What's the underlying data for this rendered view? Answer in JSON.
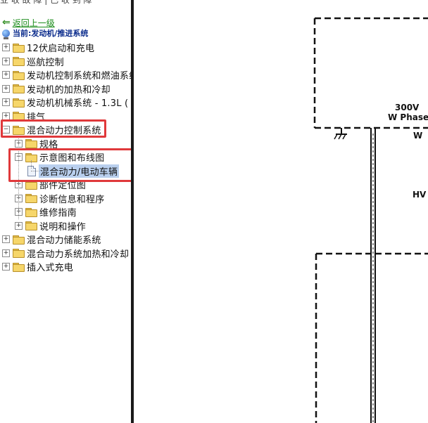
{
  "header": {
    "top_cut_text": "业 收 故 障 | 已 收 到 障"
  },
  "nav": {
    "back_label": "返回上一级",
    "current_label": "当前:发动机/推进系统"
  },
  "tree": {
    "items": [
      {
        "label": "12伏启动和充电",
        "level": 0,
        "expanded": false,
        "type": "folder"
      },
      {
        "label": "巡航控制",
        "level": 0,
        "expanded": false,
        "type": "folder"
      },
      {
        "label": "发动机控制系统和燃油系统",
        "level": 0,
        "expanded": false,
        "type": "folder"
      },
      {
        "label": "发动机的加热和冷却",
        "level": 0,
        "expanded": false,
        "type": "folder"
      },
      {
        "label": "发动机机械系统 - 1.3L (",
        "level": 0,
        "expanded": false,
        "type": "folder"
      },
      {
        "label": "排气",
        "level": 0,
        "expanded": false,
        "type": "folder"
      },
      {
        "label": "混合动力控制系统",
        "level": 0,
        "expanded": true,
        "type": "folder"
      },
      {
        "label": "规格",
        "level": 1,
        "expanded": false,
        "type": "folder"
      },
      {
        "label": "示意图和布线图",
        "level": 1,
        "expanded": true,
        "type": "folder"
      },
      {
        "label": "混合动力/电动车辆",
        "level": 2,
        "expanded": false,
        "type": "doc",
        "selected": true
      },
      {
        "label": "部件定位图",
        "level": 1,
        "expanded": false,
        "type": "folder"
      },
      {
        "label": "诊断信息和程序",
        "level": 1,
        "expanded": false,
        "type": "folder"
      },
      {
        "label": "维修指南",
        "level": 1,
        "expanded": false,
        "type": "folder"
      },
      {
        "label": "说明和操作",
        "level": 1,
        "expanded": false,
        "type": "folder"
      },
      {
        "label": "混合动力储能系统",
        "level": 0,
        "expanded": false,
        "type": "folder"
      },
      {
        "label": "混合动力系统加热和冷却",
        "level": 0,
        "expanded": false,
        "type": "folder"
      },
      {
        "label": "插入式充电",
        "level": 0,
        "expanded": false,
        "type": "folder"
      }
    ]
  },
  "diagram": {
    "label_voltage": "300V",
    "label_phase": "W Phase",
    "label_w": "W",
    "label_hv": "HV"
  },
  "colors": {
    "highlight": "#e0393b",
    "selection": "#b9cfee",
    "link": "#1a8c1a",
    "current": "#0a2b8c"
  }
}
